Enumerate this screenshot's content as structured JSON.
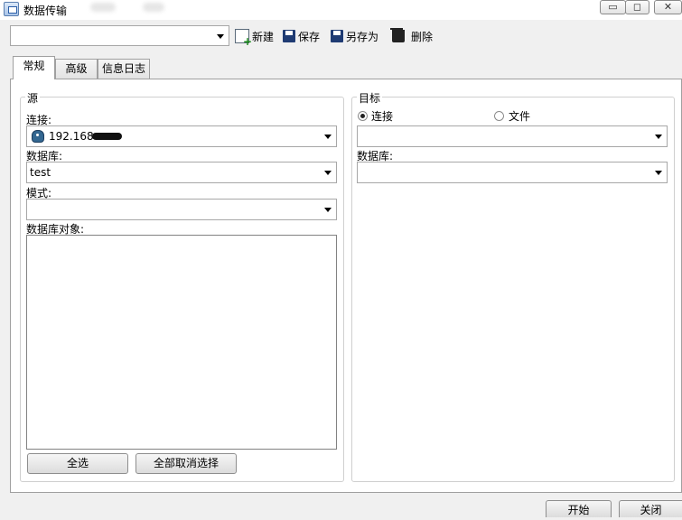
{
  "window": {
    "title": "数据传输",
    "icon": "data-transfer-icon",
    "buttons": [
      "minimize",
      "maximize",
      "close"
    ]
  },
  "toolbar": {
    "profile_value": "",
    "new_label": "新建",
    "save_label": "保存",
    "save_as_label": "另存为",
    "delete_label": "删除"
  },
  "tabs": [
    {
      "label": "常规",
      "active": true
    },
    {
      "label": "高级",
      "active": false
    },
    {
      "label": "信息日志",
      "active": false
    }
  ],
  "source": {
    "title": "源",
    "connection_label": "连接:",
    "connection_value": "192.168",
    "connection_icon": "postgresql-elephant-icon",
    "database_label": "数据库:",
    "database_value": "test",
    "schema_label": "模式:",
    "schema_value": "",
    "objects_label": "数据库对象:",
    "select_all": "全选",
    "deselect_all": "全部取消选择"
  },
  "target": {
    "title": "目标",
    "radio_connection": "连接",
    "radio_file": "文件",
    "selected": "连接",
    "connection_value": "",
    "database_label": "数据库:",
    "database_value": ""
  },
  "footer": {
    "start": "开始",
    "close": "关闭"
  }
}
